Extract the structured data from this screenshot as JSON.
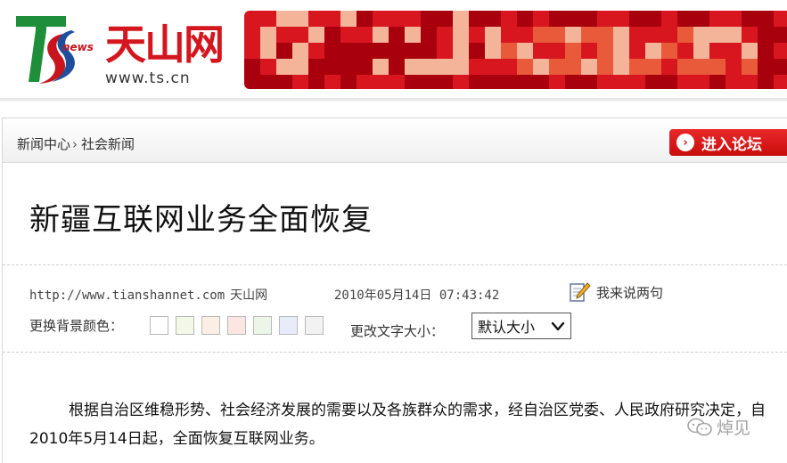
{
  "header": {
    "logo": {
      "badge": "news",
      "name": "天山网",
      "url": "www.ts.cn",
      "colors": {
        "red": "#d4161e",
        "green": "#1f8e3a",
        "blue": "#1d4f9c"
      }
    },
    "banner": {
      "colors": [
        "#a8000c",
        "#d81620",
        "#e85a3a",
        "#f4b49a"
      ]
    }
  },
  "breadcrumb": {
    "items": [
      "新闻中心",
      "社会新闻"
    ],
    "separator": "›"
  },
  "forum_button": {
    "label": "进入论坛",
    "icon": "arrow-right-circle-icon",
    "color": "#d81a1a"
  },
  "article": {
    "title": "新疆互联网业务全面恢复",
    "source_url": "http://www.tianshannet.com",
    "source_name": "天山网",
    "datetime": "2010年05月14日 07:43:42",
    "comment_label": "我来说两句",
    "comment_icon": "pencil-paper-icon",
    "body": "根据自治区维稳形势、社会经济发展的需要以及各族群众的需求，经自治区党委、人民政府研究决定，自2010年5月14日起，全面恢复互联网业务。"
  },
  "tools": {
    "background_label": "更换背景颜色：",
    "background_swatches": [
      "#ffffff",
      "#f3f8e6",
      "#fbeee4",
      "#fbe6e2",
      "#ebf6e9",
      "#e8ebfa",
      "#f2f2f2"
    ],
    "font_size_label": "更改文字大小：",
    "font_size_value": "默认大小"
  },
  "watermark": {
    "text": "焯见",
    "icon": "wechat-icon"
  }
}
